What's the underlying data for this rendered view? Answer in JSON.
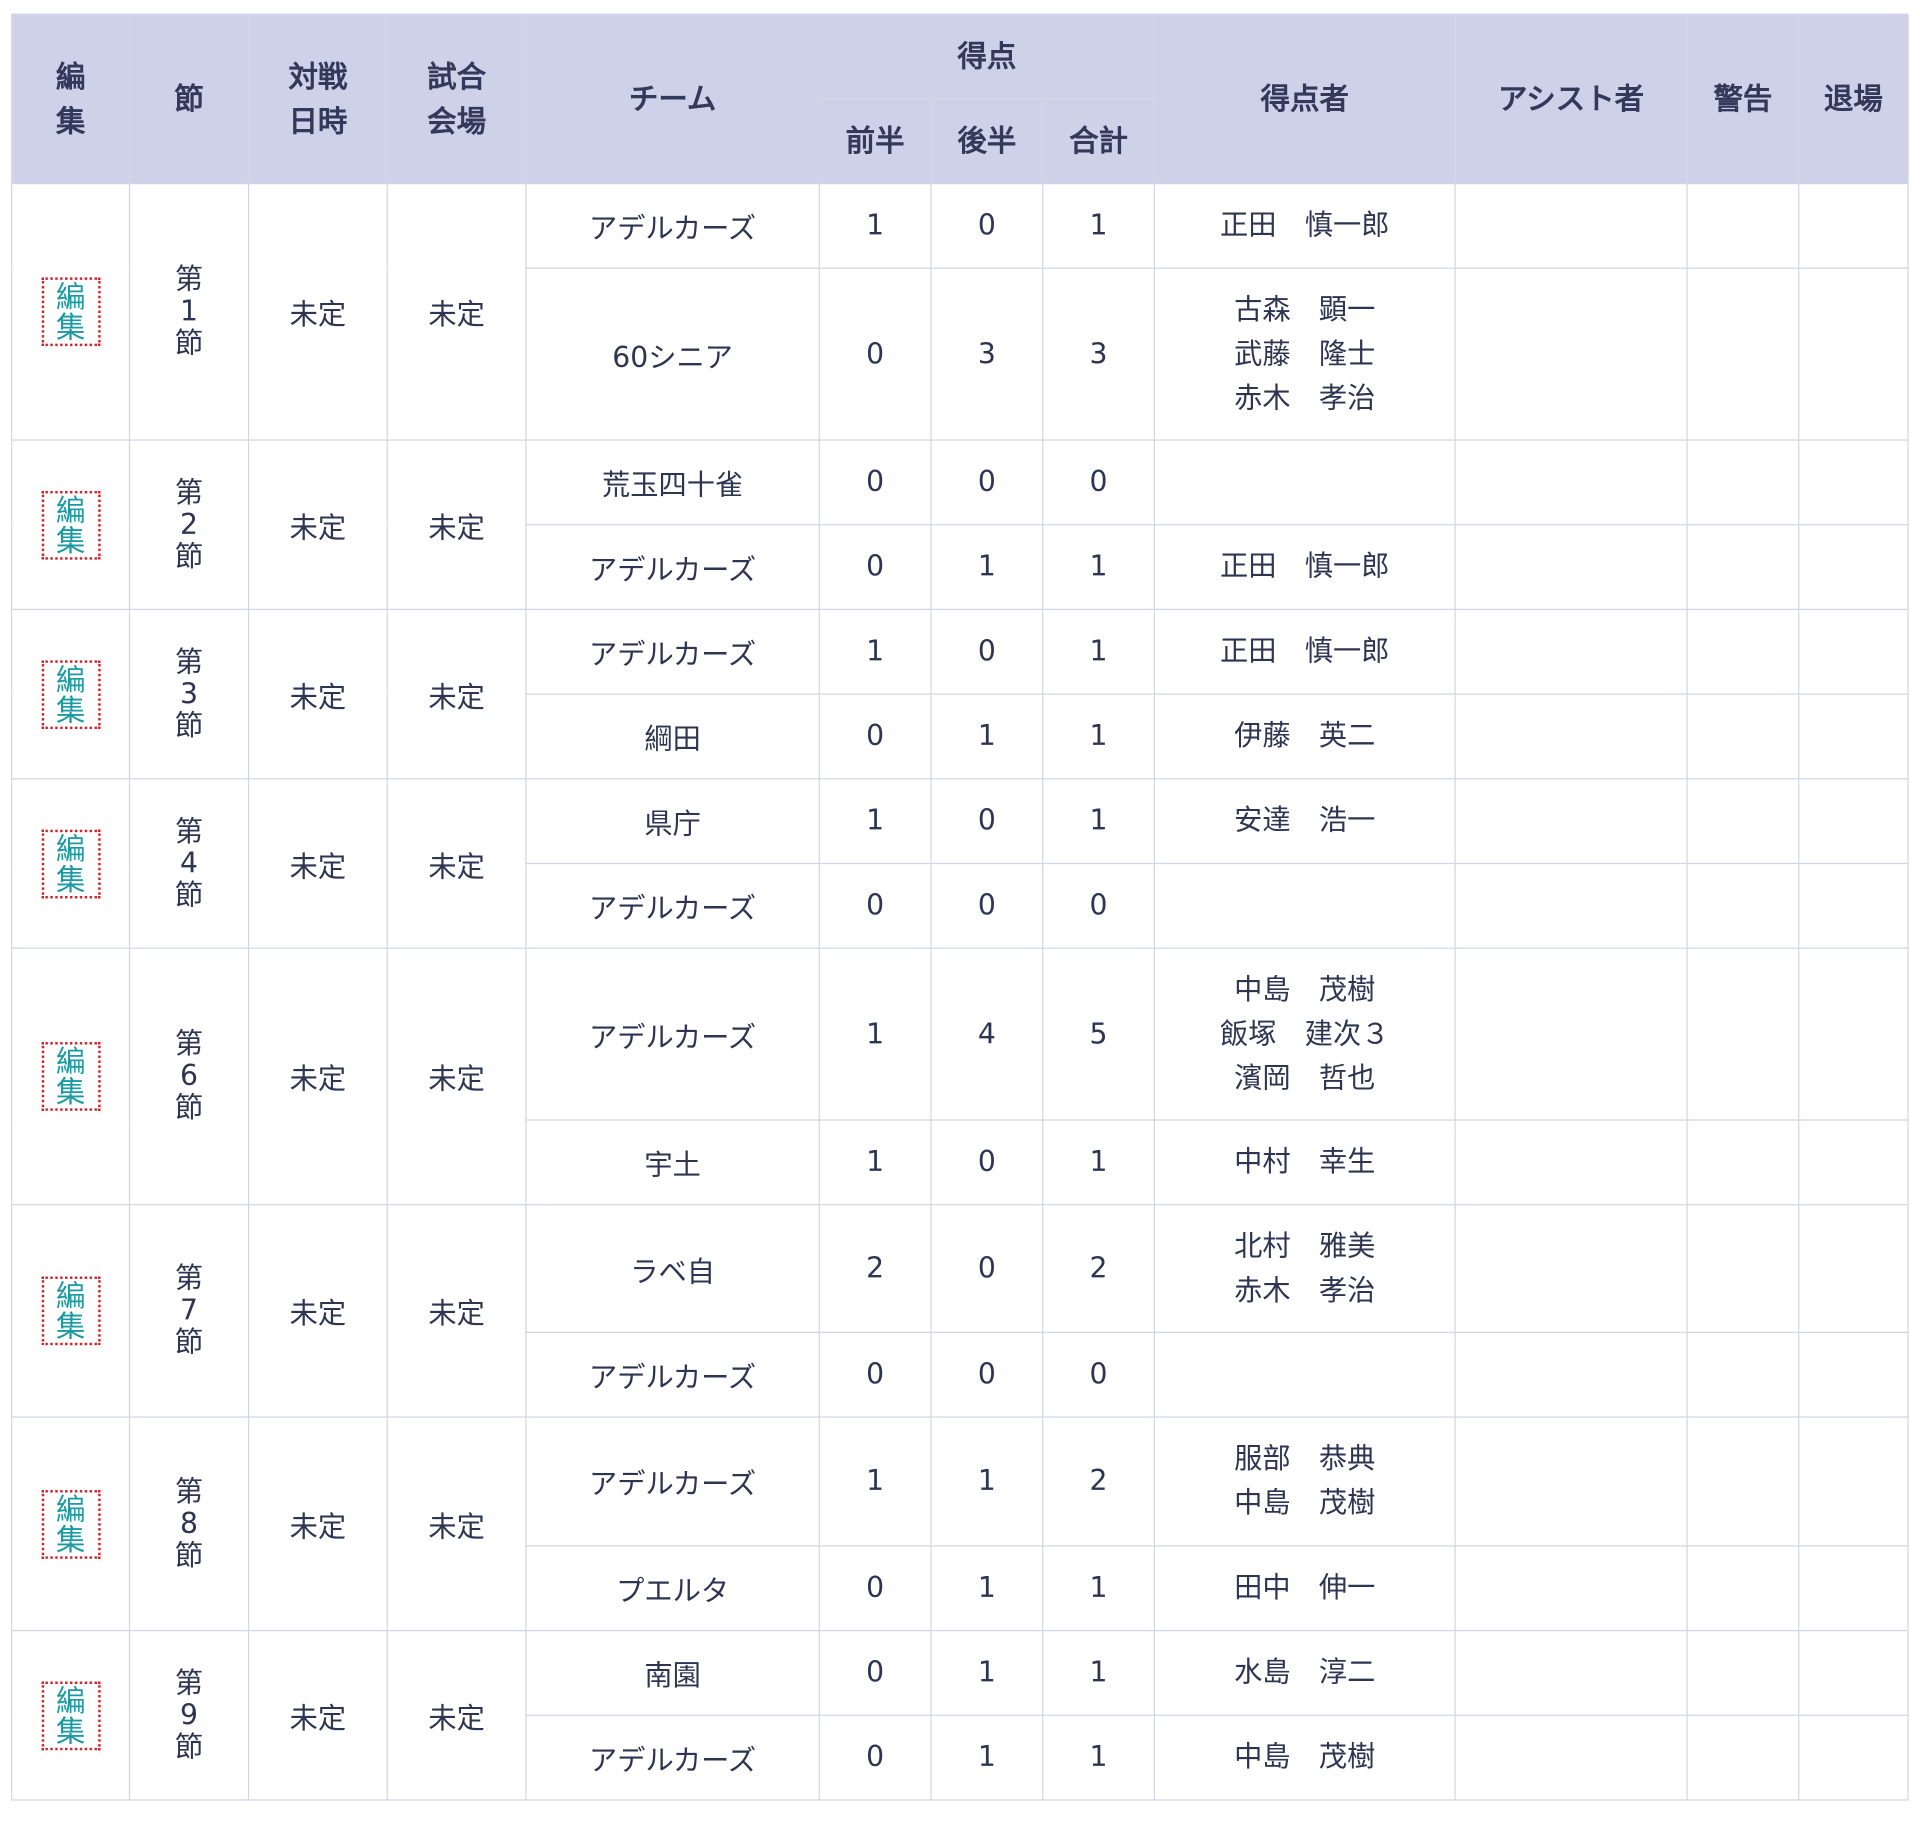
{
  "header": {
    "edit": [
      "編",
      "集"
    ],
    "section": "節",
    "datetime": [
      "対戦",
      "日時"
    ],
    "venue": [
      "試合",
      "会場"
    ],
    "team": "チーム",
    "score": "得点",
    "first_half": "前半",
    "second_half": "後半",
    "total": "合計",
    "scorers": "得点者",
    "assists": "アシスト者",
    "cautions": "警告",
    "dismissals": "退場"
  },
  "edit_label": [
    "編",
    "集"
  ],
  "matches": [
    {
      "section": [
        "第",
        "1",
        "節"
      ],
      "datetime": "未定",
      "venue": "未定",
      "teams": [
        {
          "name": "アデルカーズ",
          "first": "1",
          "second": "0",
          "total": "1",
          "scorers": [
            "正田　慎一郎"
          ]
        },
        {
          "name": "60シニア",
          "first": "0",
          "second": "3",
          "total": "3",
          "scorers": [
            "古森　顕一",
            "武藤　隆士",
            "赤木　孝治"
          ]
        }
      ]
    },
    {
      "section": [
        "第",
        "2",
        "節"
      ],
      "datetime": "未定",
      "venue": "未定",
      "teams": [
        {
          "name": "荒玉四十雀",
          "first": "0",
          "second": "0",
          "total": "0",
          "scorers": []
        },
        {
          "name": "アデルカーズ",
          "first": "0",
          "second": "1",
          "total": "1",
          "scorers": [
            "正田　慎一郎"
          ]
        }
      ]
    },
    {
      "section": [
        "第",
        "3",
        "節"
      ],
      "datetime": "未定",
      "venue": "未定",
      "teams": [
        {
          "name": "アデルカーズ",
          "first": "1",
          "second": "0",
          "total": "1",
          "scorers": [
            "正田　慎一郎"
          ]
        },
        {
          "name": "綱田",
          "first": "0",
          "second": "1",
          "total": "1",
          "scorers": [
            "伊藤　英二"
          ]
        }
      ]
    },
    {
      "section": [
        "第",
        "4",
        "節"
      ],
      "datetime": "未定",
      "venue": "未定",
      "teams": [
        {
          "name": "県庁",
          "first": "1",
          "second": "0",
          "total": "1",
          "scorers": [
            "安達　浩一"
          ]
        },
        {
          "name": "アデルカーズ",
          "first": "0",
          "second": "0",
          "total": "0",
          "scorers": []
        }
      ]
    },
    {
      "section": [
        "第",
        "6",
        "節"
      ],
      "datetime": "未定",
      "venue": "未定",
      "teams": [
        {
          "name": "アデルカーズ",
          "first": "1",
          "second": "4",
          "total": "5",
          "scorers": [
            "中島　茂樹",
            "飯塚　建次３",
            "濱岡　哲也"
          ]
        },
        {
          "name": "宇土",
          "first": "1",
          "second": "0",
          "total": "1",
          "scorers": [
            "中村　幸生"
          ]
        }
      ]
    },
    {
      "section": [
        "第",
        "7",
        "節"
      ],
      "datetime": "未定",
      "venue": "未定",
      "teams": [
        {
          "name": "ラベ自",
          "first": "2",
          "second": "0",
          "total": "2",
          "scorers": [
            "北村　雅美",
            "赤木　孝治"
          ]
        },
        {
          "name": "アデルカーズ",
          "first": "0",
          "second": "0",
          "total": "0",
          "scorers": []
        }
      ]
    },
    {
      "section": [
        "第",
        "8",
        "節"
      ],
      "datetime": "未定",
      "venue": "未定",
      "teams": [
        {
          "name": "アデルカーズ",
          "first": "1",
          "second": "1",
          "total": "2",
          "scorers": [
            "服部　恭典",
            "中島　茂樹"
          ]
        },
        {
          "name": "プエルタ",
          "first": "0",
          "second": "1",
          "total": "1",
          "scorers": [
            "田中　伸一"
          ]
        }
      ]
    },
    {
      "section": [
        "第",
        "9",
        "節"
      ],
      "datetime": "未定",
      "venue": "未定",
      "teams": [
        {
          "name": "南園",
          "first": "0",
          "second": "1",
          "total": "1",
          "scorers": [
            "水島　淳二"
          ]
        },
        {
          "name": "アデルカーズ",
          "first": "0",
          "second": "1",
          "total": "1",
          "scorers": [
            "中島　茂樹"
          ]
        }
      ]
    }
  ]
}
